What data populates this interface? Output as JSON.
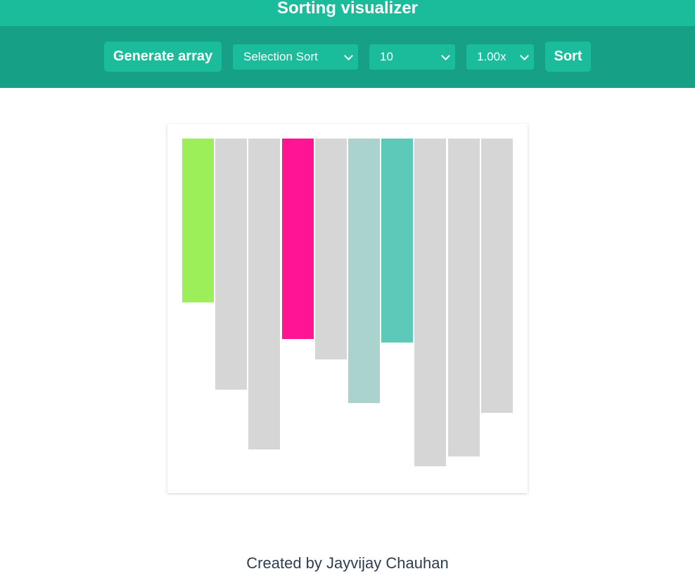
{
  "header": {
    "title": "Sorting visualizer",
    "color": "#1abc9c"
  },
  "toolbar": {
    "background": "#16a085",
    "generate_label": "Generate array",
    "algorithm_selected": "Selection Sort",
    "size_selected": "10",
    "speed_selected": "1.00x",
    "sort_label": "Sort",
    "dropdown_icon": "chevron-down-icon"
  },
  "visualizer": {
    "max_value": 480,
    "bars": [
      {
        "value": 233,
        "state": "current"
      },
      {
        "value": 357,
        "state": "default"
      },
      {
        "value": 442,
        "state": "default"
      },
      {
        "value": 285,
        "state": "minimum"
      },
      {
        "value": 314,
        "state": "default"
      },
      {
        "value": 376,
        "state": "compared"
      },
      {
        "value": 290,
        "state": "comparing"
      },
      {
        "value": 466,
        "state": "default"
      },
      {
        "value": 452,
        "state": "default"
      },
      {
        "value": 390,
        "state": "default"
      }
    ],
    "colors": {
      "default": "#d6d6d6",
      "current": "#9def5a",
      "minimum": "#ff1493",
      "compared": "#aad3ce",
      "comparing": "#5cc9b9"
    }
  },
  "footer": {
    "credit": "Created by Jayvijay Chauhan"
  }
}
